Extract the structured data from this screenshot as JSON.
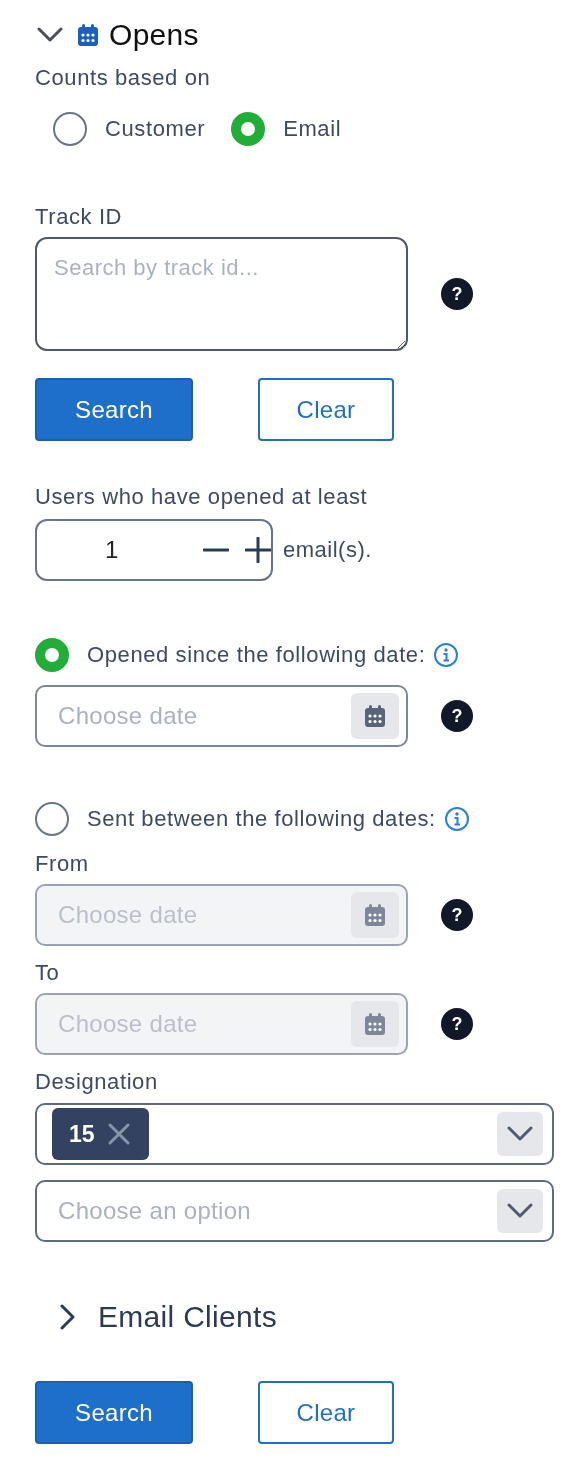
{
  "section": {
    "title": "Opens",
    "expanded": true
  },
  "counts_based_on": {
    "label": "Counts based on",
    "options": [
      {
        "label": "Customer",
        "selected": false
      },
      {
        "label": "Email",
        "selected": true
      }
    ]
  },
  "track_id": {
    "label": "Track ID",
    "placeholder": "Search by track id...",
    "help": "?"
  },
  "track_buttons": [
    {
      "kind": "primary",
      "label": "Search"
    },
    {
      "kind": "secondary",
      "label": "Clear"
    }
  ],
  "min_opens": {
    "label": "Users who have opened at least",
    "value": "1",
    "suffix": "email(s)."
  },
  "date_filters": [
    {
      "kind": "single",
      "label": "Opened since the following date:",
      "selected": true,
      "fields": [
        {
          "placeholder": "Choose date",
          "disabled": false,
          "help": "?"
        }
      ]
    },
    {
      "kind": "range",
      "label": "Sent between the following dates:",
      "selected": false,
      "fields": [
        {
          "label": "From",
          "placeholder": "Choose date",
          "disabled": true,
          "help": "?"
        },
        {
          "label": "To",
          "placeholder": "Choose date",
          "disabled": true,
          "help": "?"
        }
      ]
    }
  ],
  "designation": {
    "label": "Designation",
    "selects": [
      {
        "tags": [
          "15"
        ]
      },
      {
        "placeholder": "Choose an option"
      }
    ]
  },
  "email_clients": {
    "title": "Email Clients",
    "expanded": false
  },
  "buttons": [
    {
      "kind": "primary",
      "label": "Search"
    },
    {
      "kind": "secondary",
      "label": "Clear"
    }
  ]
}
